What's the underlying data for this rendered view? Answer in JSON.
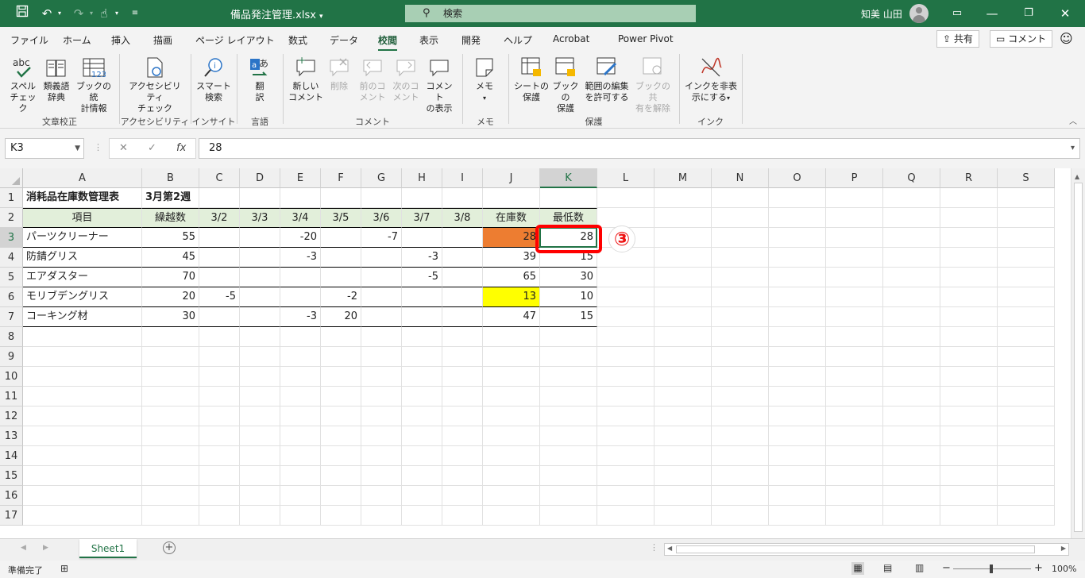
{
  "titlebar": {
    "filename": "備品発注管理.xlsx",
    "search_placeholder": "検索",
    "user": "知美 山田"
  },
  "menu": {
    "tabs": [
      "ファイル",
      "ホーム",
      "挿入",
      "描画",
      "ページ レイアウト",
      "数式",
      "データ",
      "校閲",
      "表示",
      "開発",
      "ヘルプ",
      "Acrobat",
      "Power Pivot"
    ],
    "active": "校閲",
    "share": "共有",
    "comment": "コメント"
  },
  "ribbon": {
    "buttons": {
      "spell": [
        "スペル",
        "チェック"
      ],
      "thesaurus": [
        "類義語",
        "辞典"
      ],
      "stats": [
        "ブックの統",
        "計情報"
      ],
      "access": [
        "アクセシビリティ",
        "チェック"
      ],
      "smart": [
        "スマート",
        "検索"
      ],
      "translate": [
        "翻",
        "訳"
      ],
      "newc": [
        "新しい",
        "コメント"
      ],
      "delc": [
        "削除"
      ],
      "prevc": [
        "前のコ",
        "メント"
      ],
      "nextc": [
        "次のコ",
        "メント"
      ],
      "showc": [
        "コメント",
        "の表示"
      ],
      "memo": [
        "メモ"
      ],
      "protsheet": [
        "シートの",
        "保護"
      ],
      "protbook": [
        "ブックの",
        "保護"
      ],
      "allowedit": [
        "範囲の編集",
        "を許可する"
      ],
      "unshare": [
        "ブックの共",
        "有を解除"
      ],
      "hideink": [
        "インクを非表",
        "示にする"
      ]
    },
    "groups": {
      "proofing": "文章校正",
      "accessibility": "アクセシビリティ",
      "insights": "インサイト",
      "language": "言語",
      "comments": "コメント",
      "memo": "メモ",
      "protect": "保護",
      "ink": "インク"
    }
  },
  "formula": {
    "namebox": "K3",
    "value": "28"
  },
  "sheet": {
    "columns": [
      "A",
      "B",
      "C",
      "D",
      "E",
      "F",
      "G",
      "H",
      "I",
      "J",
      "K",
      "L",
      "M",
      "N",
      "O",
      "P",
      "Q",
      "R",
      "S"
    ],
    "rows": [
      "1",
      "2",
      "3",
      "4",
      "5",
      "6",
      "7",
      "8",
      "9",
      "10",
      "11",
      "12",
      "13",
      "14",
      "15",
      "16",
      "17"
    ],
    "title": "消耗品在庫数管理表",
    "week": "3月第2週",
    "headers": [
      "項目",
      "繰越数",
      "3/2",
      "3/3",
      "3/4",
      "3/5",
      "3/6",
      "3/7",
      "3/8",
      "在庫数",
      "最低数"
    ],
    "data": [
      [
        "パーツクリーナー",
        "55",
        "",
        "",
        "-20",
        "",
        "-7",
        "",
        "",
        "28",
        "28"
      ],
      [
        "防錆グリス",
        "45",
        "",
        "",
        "-3",
        "",
        "",
        "-3",
        "",
        "39",
        "15"
      ],
      [
        "エアダスター",
        "70",
        "",
        "",
        "",
        "",
        "",
        "-5",
        "",
        "65",
        "30"
      ],
      [
        "モリブデングリス",
        "20",
        "-5",
        "",
        "",
        "-2",
        "",
        "",
        "",
        "13",
        "10"
      ],
      [
        "コーキング材",
        "30",
        "",
        "",
        "-3",
        "20",
        "",
        "",
        "",
        "47",
        "15"
      ]
    ],
    "highlight_colors": {
      "orange": "#ed7d31",
      "yellow": "#ffff00",
      "header_fill": "#e2efda"
    },
    "selected_cell": "K3"
  },
  "sheettab": "Sheet1",
  "status": {
    "ready": "準備完了",
    "zoom": "100%"
  },
  "annotation": {
    "label": "③"
  }
}
